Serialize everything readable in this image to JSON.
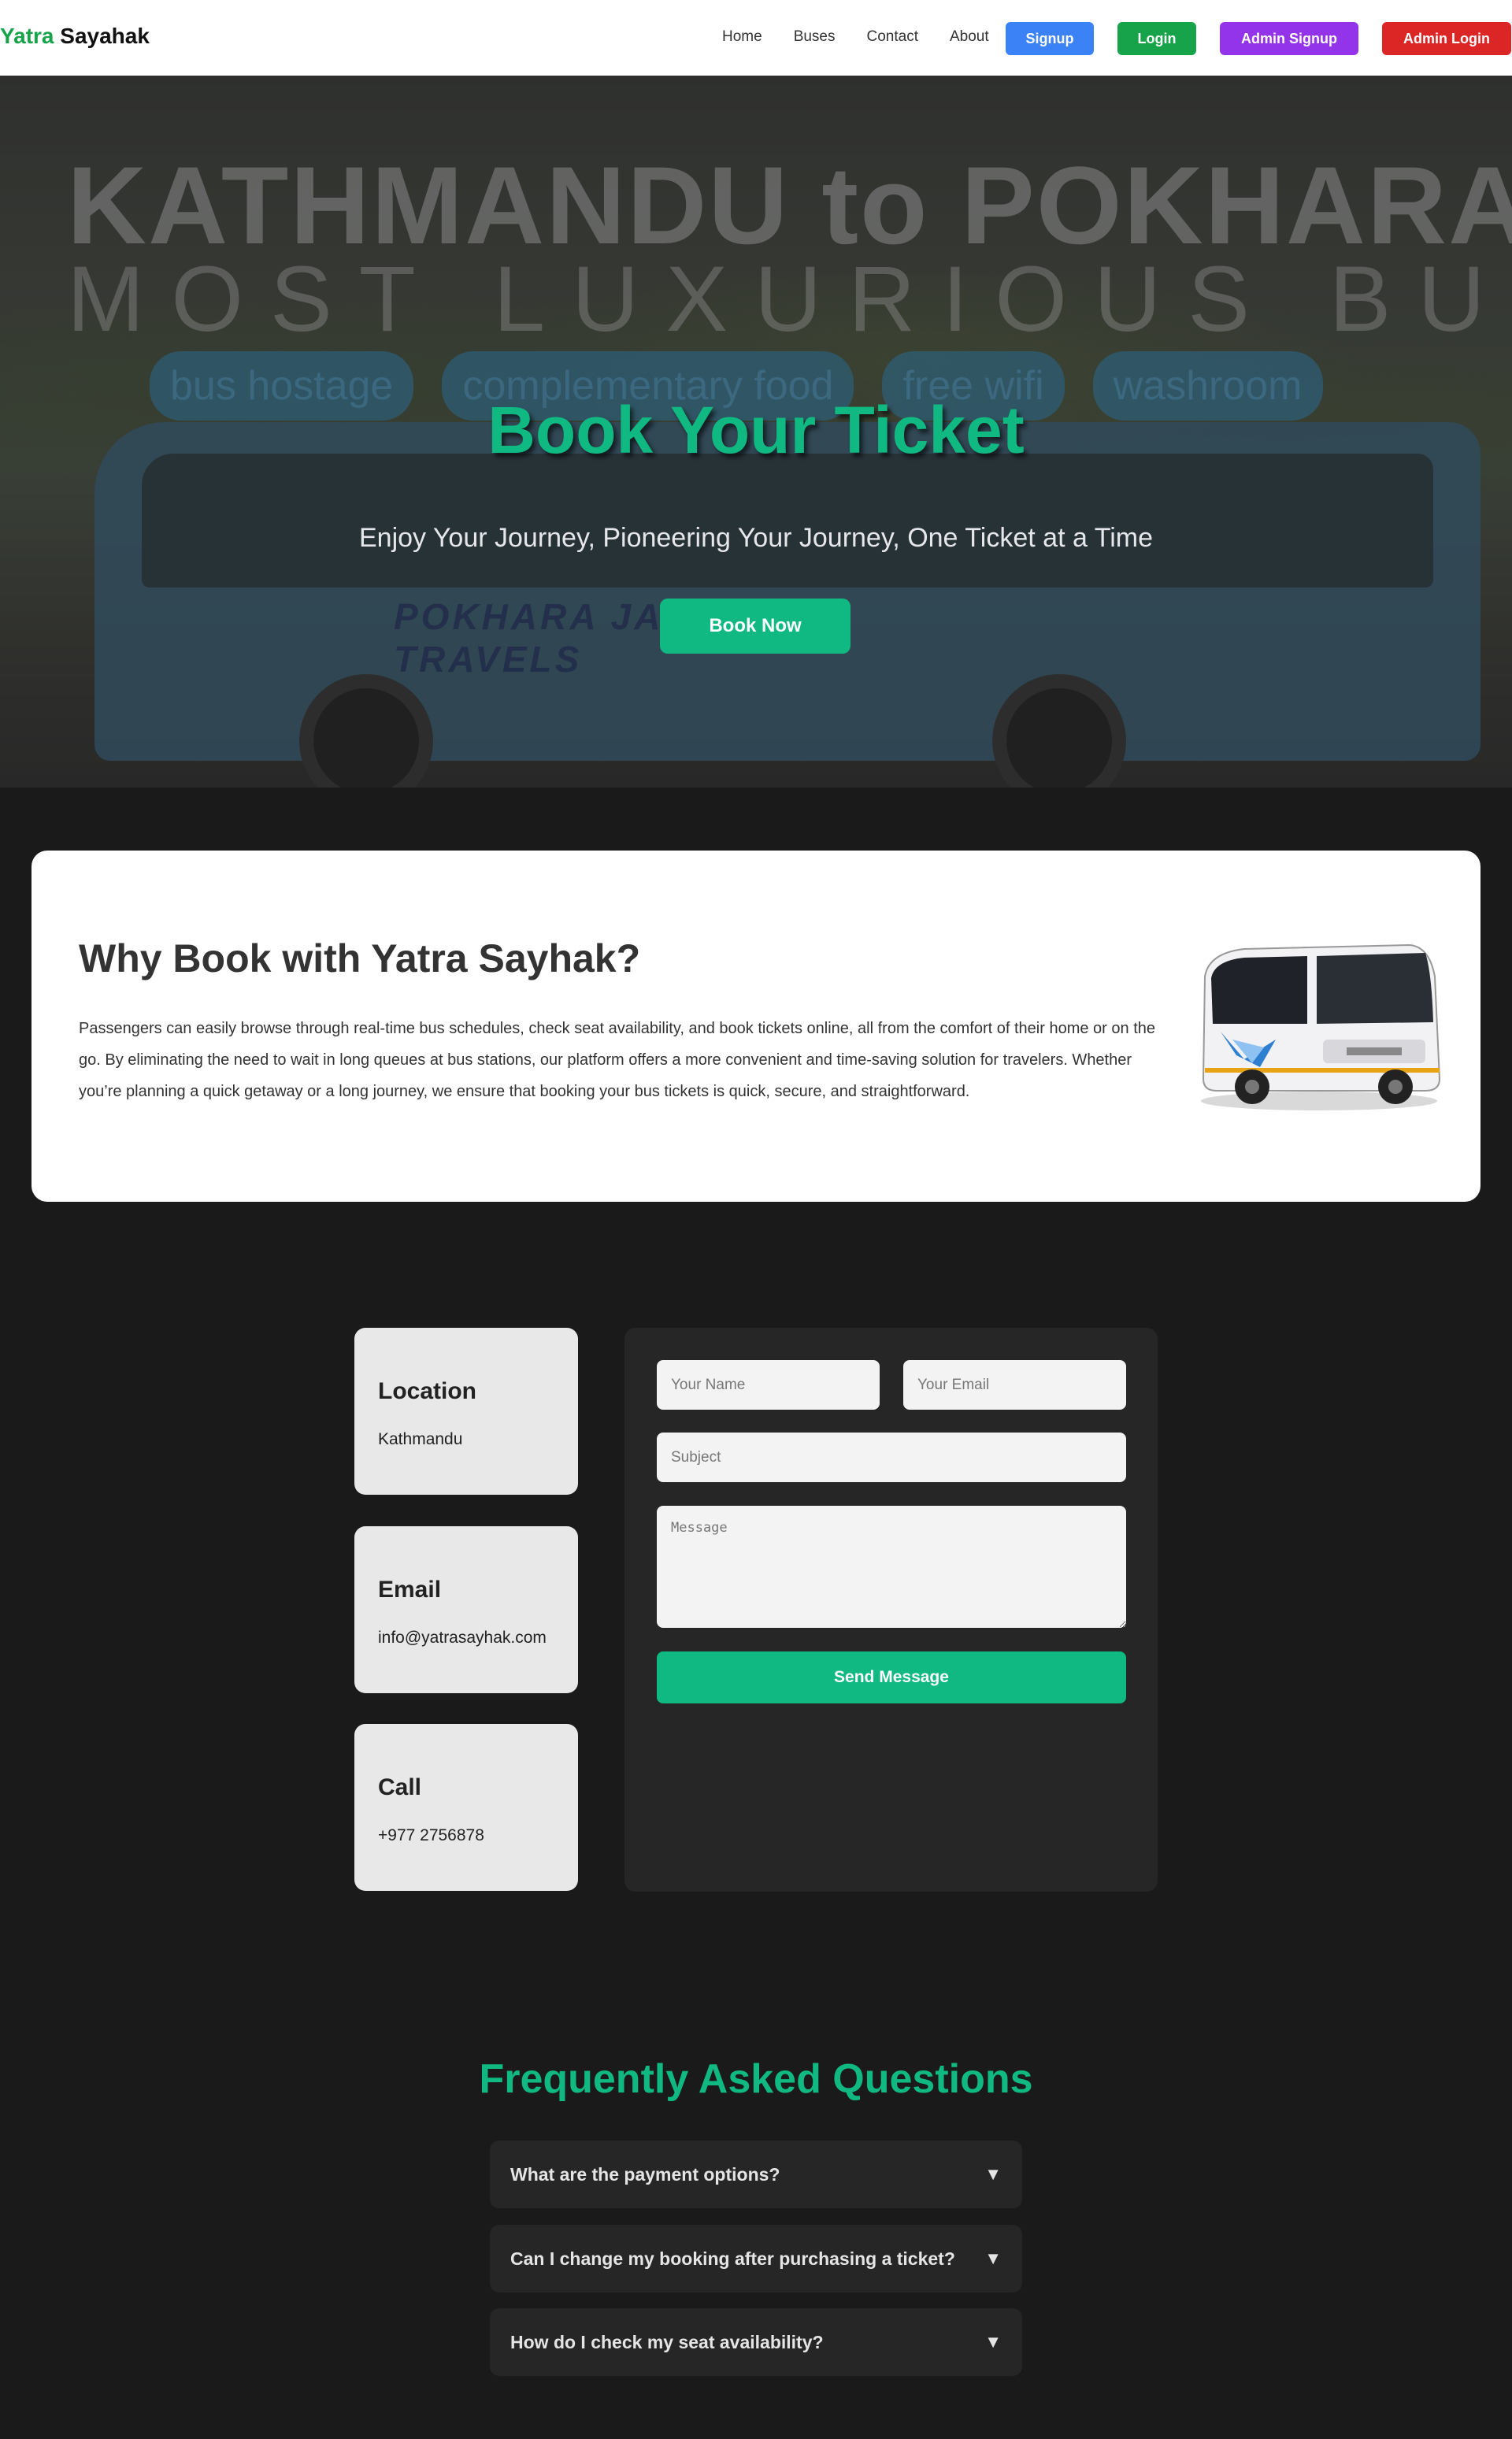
{
  "brand": {
    "part1": "Yatra",
    "part2": " Sayahak"
  },
  "nav": {
    "links": [
      "Home",
      "Buses",
      "Contact",
      "About"
    ],
    "signup": "Signup",
    "login": "Login",
    "admin_signup": "Admin Signup",
    "admin_login": "Admin Login"
  },
  "colors": {
    "accent": "#10b981",
    "signup": "#3b82f6",
    "login": "#16a34a",
    "admin_signup": "#9333ea",
    "admin_login": "#dc2626"
  },
  "hero": {
    "bg_line1": "KATHMANDU to POKHARA",
    "bg_line2": "MOST LUXURIOUS BUS",
    "bg_pills": [
      "bus hostage",
      "complementary food",
      "free wifi",
      "washroom"
    ],
    "bus_text": "POKHARA JAGDAMBA TRAVELS",
    "title": "Book Your Ticket",
    "subtitle": "Enjoy Your Journey, Pioneering Your Journey, One Ticket at a Time",
    "cta": "Book Now"
  },
  "why": {
    "title": "Why Book with Yatra Sayhak?",
    "body": "Passengers can easily browse through real-time bus schedules, check seat availability, and book tickets online, all from the comfort of their home or on the go. By eliminating the need to wait in long queues at bus stations, our platform offers a more convenient and time-saving solution for travelers. Whether you’re planning a quick getaway or a long journey, we ensure that booking your bus tickets is quick, secure, and straightforward."
  },
  "contact": {
    "cards": [
      {
        "title": "Location",
        "value": "Kathmandu"
      },
      {
        "title": "Email",
        "value": "info@yatrasayhak.com"
      },
      {
        "title": "Call",
        "value": "+977 2756878"
      }
    ],
    "form": {
      "name_placeholder": "Your Name",
      "email_placeholder": "Your Email",
      "subject_placeholder": "Subject",
      "message_placeholder": "Message",
      "submit": "Send Message"
    }
  },
  "faq": {
    "title": "Frequently Asked Questions",
    "items": [
      {
        "q": "What are the payment options?",
        "icon": "▼"
      },
      {
        "q": "Can I change my booking after purchasing a ticket?",
        "icon": "▼"
      },
      {
        "q": "How do I check my seat availability?",
        "icon": "▼"
      }
    ]
  }
}
